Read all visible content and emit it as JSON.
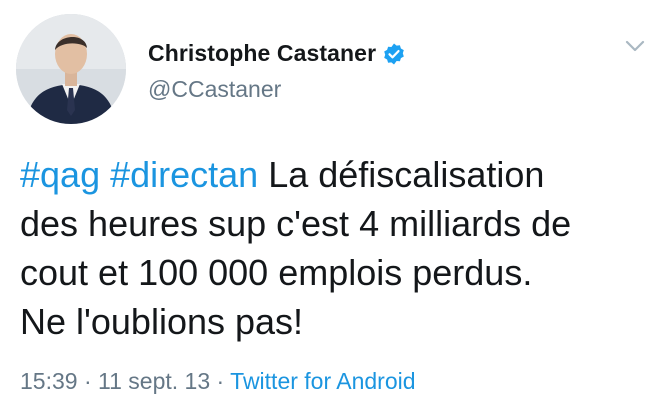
{
  "user": {
    "name": "Christophe Castaner",
    "handle": "@CCastaner"
  },
  "tweet": {
    "hashtag1": "#qag",
    "hashtag2": "#directan",
    "text_line1": " La défiscalisation",
    "text_line2": "des heures sup c'est 4 milliards de",
    "text_line3": "cout et 100 000 emplois perdus.",
    "text_line4": "Ne l'oublions pas!"
  },
  "meta": {
    "time": "15:39",
    "separator": "·",
    "date": "11 sept. 13",
    "source": "Twitter for Android"
  },
  "colors": {
    "link": "#1b95e0",
    "text": "#14171a",
    "secondary": "#657786"
  },
  "icons": {
    "verified": "verified-badge-icon",
    "menu": "chevron-down-icon"
  }
}
